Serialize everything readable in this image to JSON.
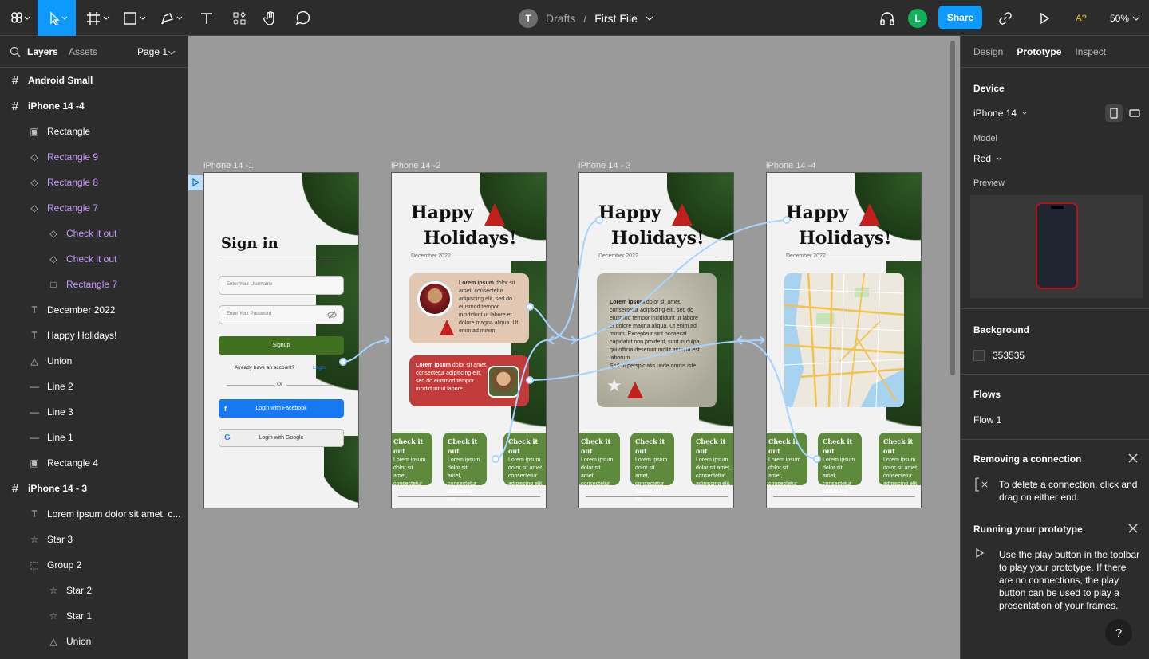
{
  "toolbar": {
    "breadcrumb_avatar": "T",
    "breadcrumb_parent": "Drafts",
    "breadcrumb_sep": "/",
    "file_name": "First File",
    "user_avatar": "L",
    "share_label": "Share",
    "missing_fonts": "A?",
    "zoom": "50%"
  },
  "left_panel": {
    "tabs": [
      "Layers",
      "Assets"
    ],
    "page": "Page 1",
    "layers": [
      {
        "icon": "frame-icon",
        "label": "Android Small",
        "indent": 0,
        "bold": true,
        "purple": false
      },
      {
        "icon": "frame-icon",
        "label": "iPhone 14 -4",
        "indent": 0,
        "bold": true,
        "purple": false
      },
      {
        "icon": "image-icon",
        "label": "Rectangle",
        "indent": 1,
        "bold": false,
        "purple": false
      },
      {
        "icon": "instance-icon",
        "label": "Rectangle 9",
        "indent": 1,
        "bold": false,
        "purple": true
      },
      {
        "icon": "instance-icon",
        "label": "Rectangle 8",
        "indent": 1,
        "bold": false,
        "purple": true
      },
      {
        "icon": "instance-icon",
        "label": "Rectangle 7",
        "indent": 1,
        "bold": false,
        "purple": true
      },
      {
        "icon": "instance-icon",
        "label": "Check it out",
        "indent": 2,
        "bold": false,
        "purple": true
      },
      {
        "icon": "instance-icon",
        "label": "Check it out",
        "indent": 2,
        "bold": false,
        "purple": true
      },
      {
        "icon": "rect-icon",
        "label": "Rectangle 7",
        "indent": 2,
        "bold": false,
        "purple": true
      },
      {
        "icon": "text-icon",
        "label": "December 2022",
        "indent": 1,
        "bold": false,
        "purple": false
      },
      {
        "icon": "text-icon",
        "label": "Happy Holidays!",
        "indent": 1,
        "bold": false,
        "purple": false
      },
      {
        "icon": "union-icon",
        "label": "Union",
        "indent": 1,
        "bold": false,
        "purple": false
      },
      {
        "icon": "line-icon",
        "label": "Line 2",
        "indent": 1,
        "bold": false,
        "purple": false
      },
      {
        "icon": "line-icon",
        "label": "Line 3",
        "indent": 1,
        "bold": false,
        "purple": false
      },
      {
        "icon": "line-icon",
        "label": "Line 1",
        "indent": 1,
        "bold": false,
        "purple": false
      },
      {
        "icon": "image-icon",
        "label": "Rectangle 4",
        "indent": 1,
        "bold": false,
        "purple": false
      },
      {
        "icon": "frame-icon",
        "label": "iPhone 14 - 3",
        "indent": 0,
        "bold": true,
        "purple": false
      },
      {
        "icon": "text-icon",
        "label": "Lorem ipsum dolor sit amet, c...",
        "indent": 1,
        "bold": false,
        "purple": false
      },
      {
        "icon": "star-icon",
        "label": "Star 3",
        "indent": 1,
        "bold": false,
        "purple": false
      },
      {
        "icon": "group-icon",
        "label": "Group 2",
        "indent": 1,
        "bold": false,
        "purple": false
      },
      {
        "icon": "star-icon",
        "label": "Star 2",
        "indent": 2,
        "bold": false,
        "purple": false
      },
      {
        "icon": "star-icon",
        "label": "Star 1",
        "indent": 2,
        "bold": false,
        "purple": false
      },
      {
        "icon": "union-icon",
        "label": "Union",
        "indent": 2,
        "bold": false,
        "purple": false
      }
    ]
  },
  "canvas": {
    "frame_labels": [
      "iPhone 14 -1",
      "iPhone 14 -2",
      "iPhone 14 - 3",
      "iPhone 14 -4"
    ],
    "signin": {
      "title": "Sign in",
      "username_placeholder": "Enter Your Username",
      "password_placeholder": "Enter Your Password",
      "signup": "Signup",
      "already": "Already have an account?",
      "login": "Login",
      "or": "Or",
      "facebook": "Login with Facebook",
      "google": "Login with Google"
    },
    "happy": "Happy",
    "holidays": "Holidays!",
    "date": "December 2022",
    "card_bold": "Lorem ipsum",
    "card1_text": "dolor sit amet, consectetur adipiscing elit, sed do eiusmod tempor incididunt ut labore et dolore magna aliqua. Ut enim ad minim",
    "card2_text": "dolor sit amet, consectetur adipiscing elit, sed do eiusmod tempor incididunt ut labore.",
    "card3_text": "dolor sit amet, consectetur adipiscing elit, sed do eiusmod tempor incididunt ut labore et dolore magna aliqua. Ut enim ad minim. Excepteur sint occaecat cupidatat non proident, sunt in culpa qui officia deserunt mollit anim id est laborum.",
    "card3_extra": "Sed ut perspiciatis unde omnis iste",
    "check_title": "Check it out",
    "check_body": "Lorem ipsum dolor sit amet, consectetur adipiscing elit."
  },
  "right_panel": {
    "tabs": [
      "Design",
      "Prototype",
      "Inspect"
    ],
    "device_title": "Device",
    "device": "iPhone 14",
    "model_label": "Model",
    "model": "Red",
    "preview_label": "Preview",
    "background_title": "Background",
    "background_value": "353535",
    "flows_title": "Flows",
    "flow": "Flow 1",
    "removing_title": "Removing a connection",
    "removing_text": "To delete a connection, click and drag on either end.",
    "running_title": "Running your prototype",
    "running_text": "Use the play button in the toolbar to play your prototype. If there are no connections, the play button can be used to play a presentation of your frames.",
    "help": "?"
  },
  "colors": {
    "accent": "#0d99ff",
    "panel": "#2c2c2c",
    "canvas": "#9a9a9a",
    "component_purple": "#c79bff",
    "card_green": "#5f8a3e",
    "card_red": "#c23b3b",
    "signup_green": "#3f6f1f",
    "facebook_blue": "#1877f2",
    "connector": "#a8d4ff"
  }
}
